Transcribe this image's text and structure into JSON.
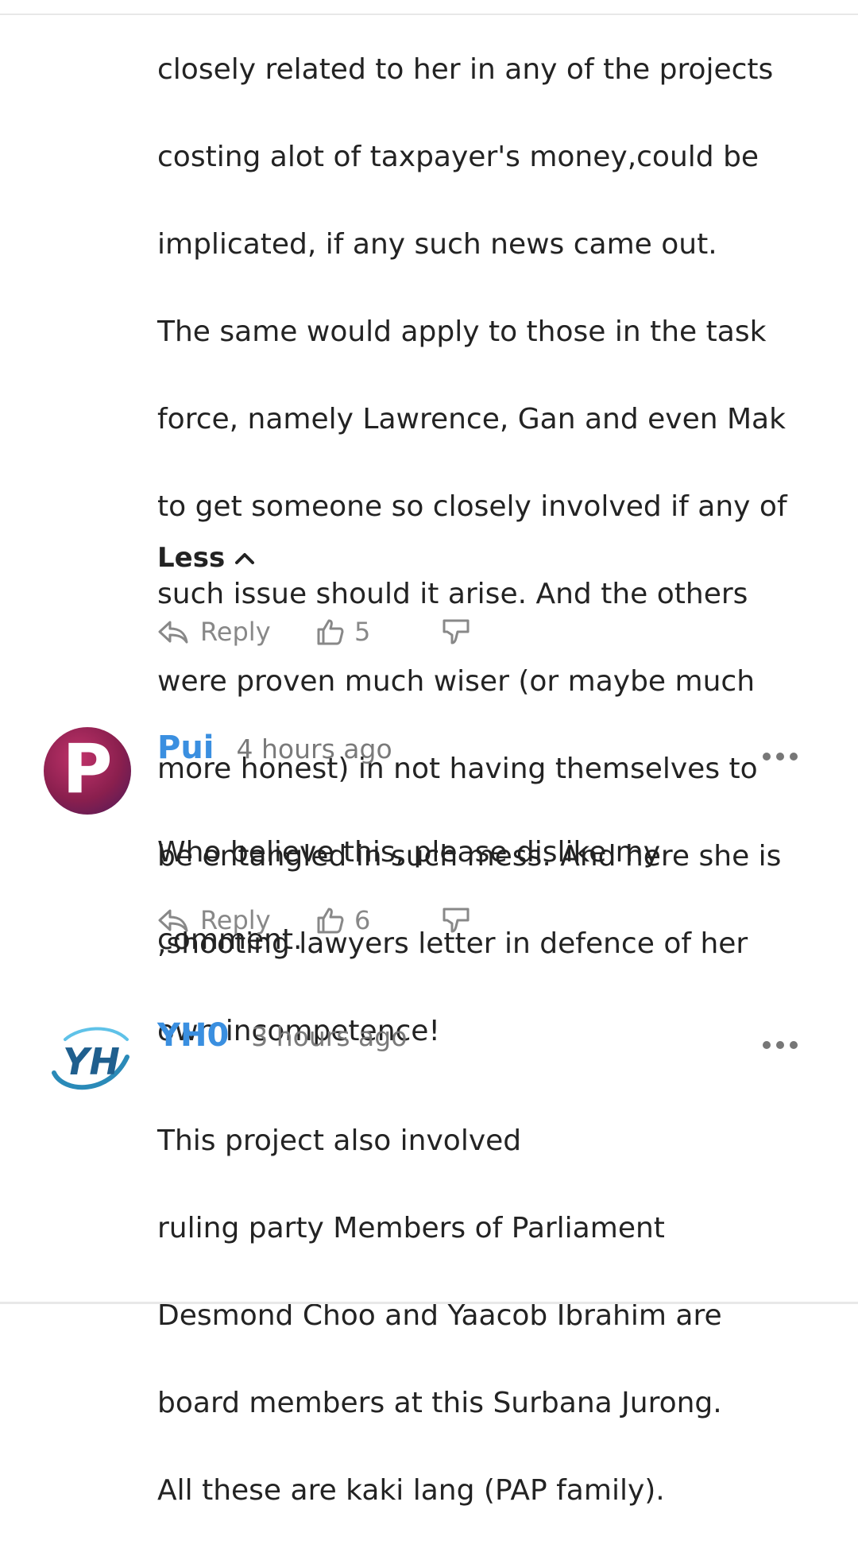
{
  "comment_top": {
    "lines": [
      "closely related to her in any of the projects",
      "costing alot of taxpayer's money,could be",
      "implicated, if any such news came out.",
      "The same would apply to those in the task",
      "force, namely Lawrence, Gan and even Mak",
      "to get someone so closely involved if any of",
      "such issue should it arise. And the others",
      "were proven much wiser (or maybe much",
      "more honest) in not having themselves to",
      "be entangled in such mess. And here she is",
      ",shooting lawyers letter in defence of her",
      "own incompetence!"
    ],
    "less_label": "Less",
    "reply_label": "Reply",
    "likes": "5"
  },
  "comment_pui": {
    "avatar_letter": "P",
    "username": "Pui",
    "time": "4 hours ago",
    "lines": [
      "Who believe this, please dislike my",
      "comment."
    ],
    "reply_label": "Reply",
    "likes": "6"
  },
  "comment_yho": {
    "avatar_text": "YH",
    "username": "YH0",
    "time": "3 hours ago",
    "lines": [
      "This project also involved",
      "ruling party Members of Parliament",
      "Desmond Choo and Yaacob Ibrahim are",
      "board members at this Surbana Jurong.",
      "All these are kaki lang (PAP family)."
    ]
  },
  "colors": {
    "username": "#3a8fe0",
    "meta": "#7a7a7a",
    "text": "#232323",
    "action": "#888888"
  }
}
